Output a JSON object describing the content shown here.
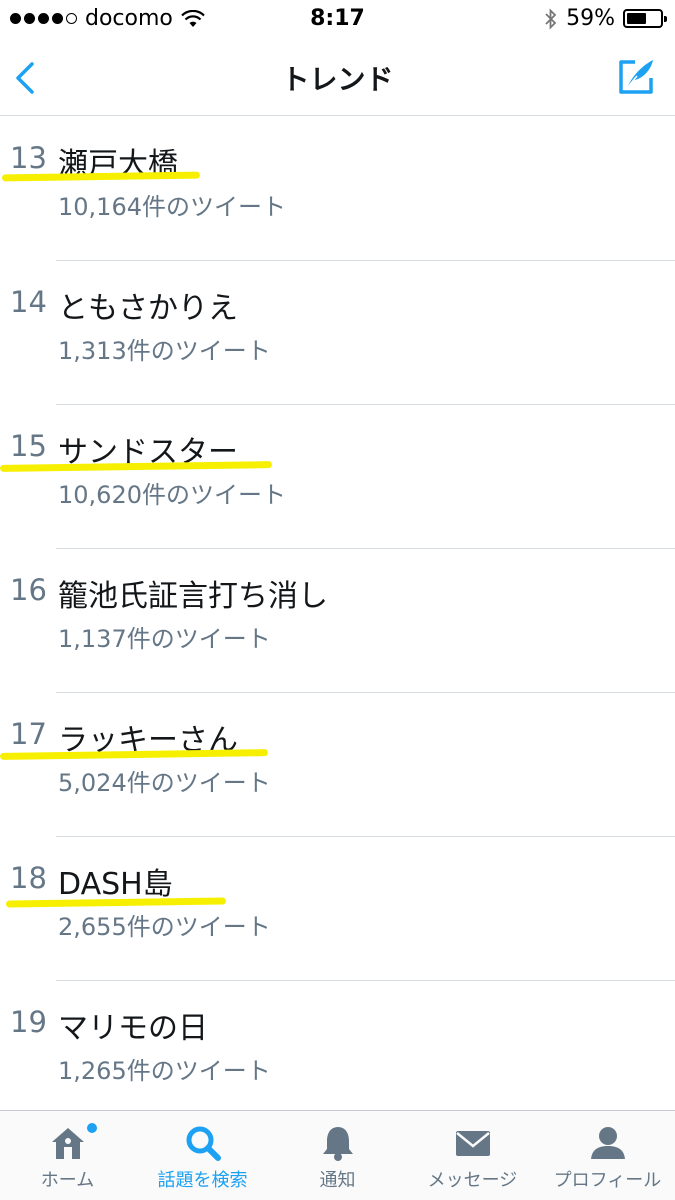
{
  "status_bar": {
    "carrier": "docomo",
    "time": "8:17",
    "battery": "59%",
    "battery_level": 0.59
  },
  "nav": {
    "title": "トレンド"
  },
  "trends": [
    {
      "rank": "13",
      "name": "瀬戸大橋",
      "count": "10,164件のツイート",
      "highlighted": true
    },
    {
      "rank": "14",
      "name": "ともさかりえ",
      "count": "1,313件のツイート",
      "highlighted": false
    },
    {
      "rank": "15",
      "name": "サンドスター",
      "count": "10,620件のツイート",
      "highlighted": true
    },
    {
      "rank": "16",
      "name": "籠池氏証言打ち消し",
      "count": "1,137件のツイート",
      "highlighted": false
    },
    {
      "rank": "17",
      "name": "ラッキーさん",
      "count": "5,024件のツイート",
      "highlighted": true
    },
    {
      "rank": "18",
      "name": "DASH島",
      "count": "2,655件のツイート",
      "highlighted": true
    },
    {
      "rank": "19",
      "name": "マリモの日",
      "count": "1,265件のツイート",
      "highlighted": false
    }
  ],
  "tabs": [
    {
      "label": "ホーム",
      "icon": "home-icon",
      "active": false
    },
    {
      "label": "話題を検索",
      "icon": "search-icon",
      "active": true
    },
    {
      "label": "通知",
      "icon": "bell-icon",
      "active": false
    },
    {
      "label": "メッセージ",
      "icon": "envelope-icon",
      "active": false
    },
    {
      "label": "プロフィール",
      "icon": "person-icon",
      "active": false
    }
  ],
  "colors": {
    "accent": "#1da1f2",
    "secondary_text": "#657786",
    "highlight": "#f6f000"
  }
}
